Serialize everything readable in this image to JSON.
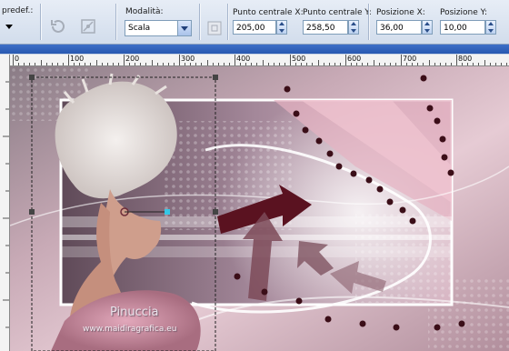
{
  "toolbar": {
    "preset_label": "predef.:",
    "mode_label": "Modalità:",
    "mode_value": "Scala",
    "center_x_label": "Punto centrale X:",
    "center_x_value": "205,00",
    "center_y_label": "Punto centrale Y:",
    "center_y_value": "258,50",
    "pos_x_label": "Posizione X:",
    "pos_x_value": "36,00",
    "pos_y_label": "Posizione Y:",
    "pos_y_value": "10,00"
  },
  "ruler": {
    "labels": [
      "0",
      "100",
      "200",
      "300",
      "400",
      "500",
      "600",
      "700",
      "800"
    ]
  },
  "canvas": {
    "watermark_name": "Pinuccia",
    "watermark_url": "www.maidiragrafica.eu"
  },
  "colors": {
    "toolbar_bg": "#dbe4f1",
    "title_bar": "#2f62b9",
    "canvas_pink": "#d8b3c0",
    "arrow_dark": "#5a1220"
  }
}
